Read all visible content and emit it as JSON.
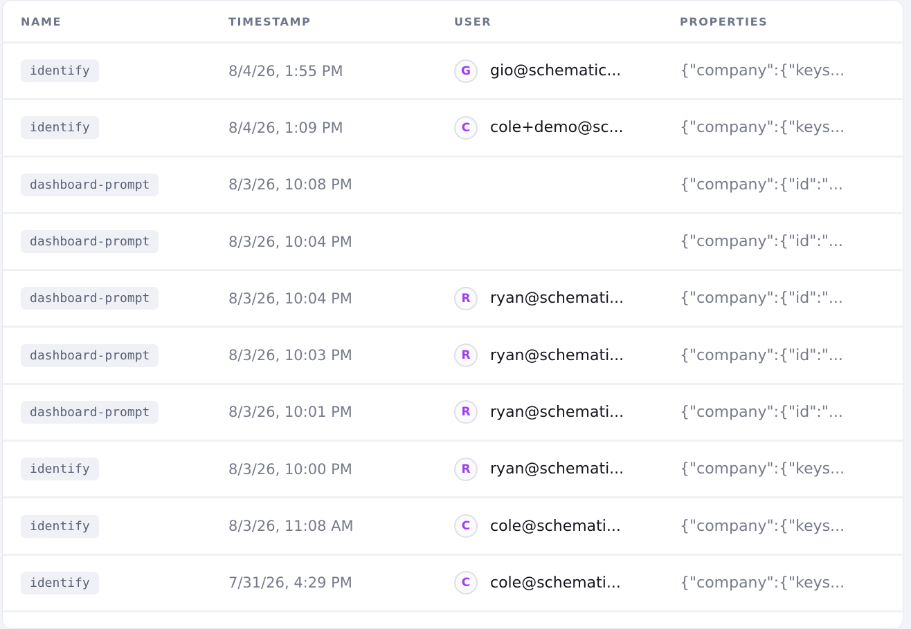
{
  "table": {
    "headers": {
      "name": "NAME",
      "timestamp": "TIMESTAMP",
      "user": "USER",
      "properties": "PROPERTIES"
    },
    "rows": [
      {
        "name": "identify",
        "timestamp": "8/4/26, 1:55 PM",
        "avatar": "G",
        "user": "gio@schematic...",
        "properties": "{\"company\":{\"keys..."
      },
      {
        "name": "identify",
        "timestamp": "8/4/26, 1:09 PM",
        "avatar": "C",
        "user": "cole+demo@sc...",
        "properties": "{\"company\":{\"keys..."
      },
      {
        "name": "dashboard-prompt",
        "timestamp": "8/3/26, 10:08 PM",
        "avatar": "",
        "user": "",
        "properties": "{\"company\":{\"id\":\"..."
      },
      {
        "name": "dashboard-prompt",
        "timestamp": "8/3/26, 10:04 PM",
        "avatar": "",
        "user": "",
        "properties": "{\"company\":{\"id\":\"..."
      },
      {
        "name": "dashboard-prompt",
        "timestamp": "8/3/26, 10:04 PM",
        "avatar": "R",
        "user": "ryan@schemati...",
        "properties": "{\"company\":{\"id\":\"..."
      },
      {
        "name": "dashboard-prompt",
        "timestamp": "8/3/26, 10:03 PM",
        "avatar": "R",
        "user": "ryan@schemati...",
        "properties": "{\"company\":{\"id\":\"..."
      },
      {
        "name": "dashboard-prompt",
        "timestamp": "8/3/26, 10:01 PM",
        "avatar": "R",
        "user": "ryan@schemati...",
        "properties": "{\"company\":{\"id\":\"..."
      },
      {
        "name": "identify",
        "timestamp": "8/3/26, 10:00 PM",
        "avatar": "R",
        "user": "ryan@schemati...",
        "properties": "{\"company\":{\"keys..."
      },
      {
        "name": "identify",
        "timestamp": "8/3/26, 11:08 AM",
        "avatar": "C",
        "user": "cole@schemati...",
        "properties": "{\"company\":{\"keys..."
      },
      {
        "name": "identify",
        "timestamp": "7/31/26, 4:29 PM",
        "avatar": "C",
        "user": "cole@schemati...",
        "properties": "{\"company\":{\"keys..."
      }
    ]
  },
  "colors": {
    "avatar_letter": "#9b3ff0",
    "tag_background": "#f0f1f6",
    "header_text": "#6f7689"
  }
}
